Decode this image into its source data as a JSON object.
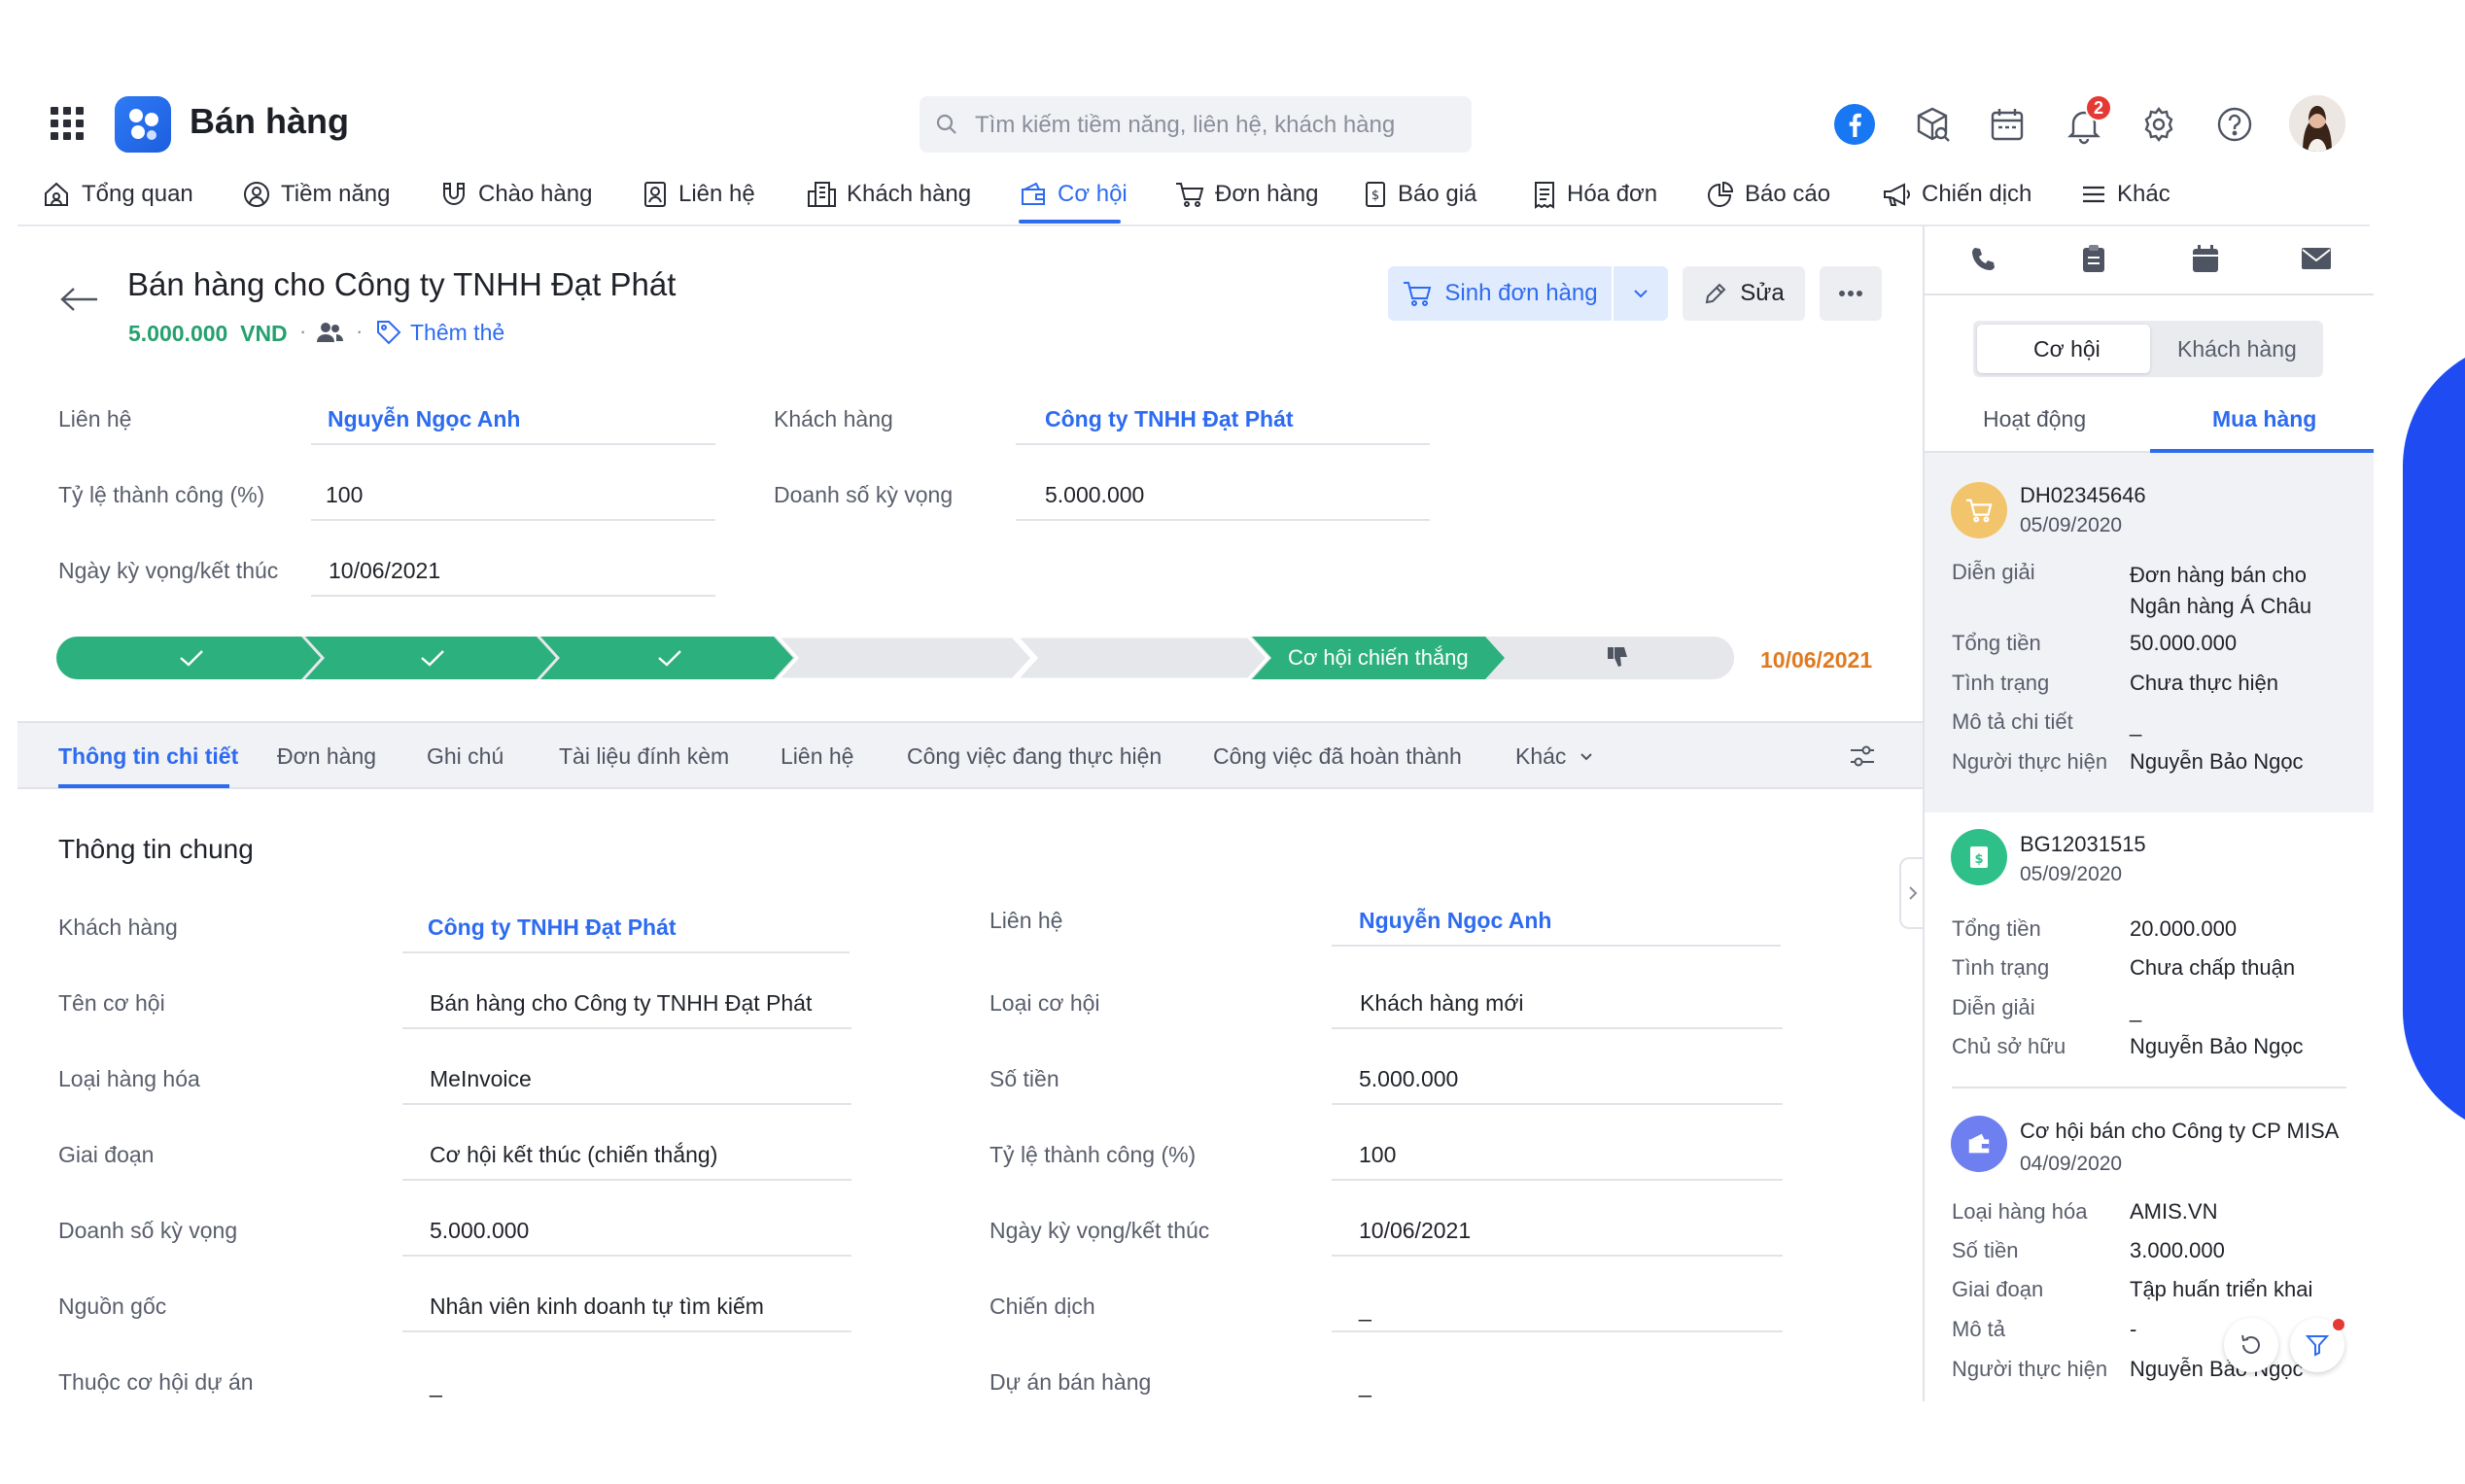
{
  "header": {
    "app_title": "Bán hàng",
    "search_placeholder": "Tìm kiếm tiềm năng, liên hệ, khách hàng",
    "notification_count": "2"
  },
  "nav": [
    {
      "label": "Tổng quan",
      "icon": "home-icon"
    },
    {
      "label": "Tiềm năng",
      "icon": "lead-icon"
    },
    {
      "label": "Chào hàng",
      "icon": "magnet-icon"
    },
    {
      "label": "Liên hệ",
      "icon": "contact-icon"
    },
    {
      "label": "Khách hàng",
      "icon": "building-icon"
    },
    {
      "label": "Cơ hội",
      "icon": "wallet-icon",
      "active": true
    },
    {
      "label": "Đơn hàng",
      "icon": "cart-icon"
    },
    {
      "label": "Báo giá",
      "icon": "quote-icon"
    },
    {
      "label": "Hóa đơn",
      "icon": "invoice-icon"
    },
    {
      "label": "Báo cáo",
      "icon": "report-icon"
    },
    {
      "label": "Chiến dịch",
      "icon": "megaphone-icon"
    },
    {
      "label": "Khác",
      "icon": "menu-icon"
    }
  ],
  "record": {
    "title": "Bán hàng cho Công ty TNHH Đạt Phát",
    "amount": "5.000.000",
    "currency": "VND",
    "add_tag": "Thêm thẻ",
    "actions": {
      "create_order": "Sinh đơn hàng",
      "edit": "Sửa"
    }
  },
  "summary": {
    "contact_label": "Liên hệ",
    "contact_value": "Nguyễn Ngọc Anh",
    "customer_label": "Khách hàng",
    "customer_value": "Công ty TNHH Đạt Phát",
    "rate_label": "Tỷ lệ thành công (%)",
    "rate_value": "100",
    "revenue_label": "Doanh số kỳ vọng",
    "revenue_value": "5.000.000",
    "date_label": "Ngày kỳ vọng/kết thúc",
    "date_value": "10/06/2021"
  },
  "pipeline": {
    "won_label": "Cơ hội chiến thắng",
    "end_date": "10/06/2021",
    "colors": {
      "done": "#2cb07e",
      "pending": "#e6e7eb"
    }
  },
  "tabs": [
    "Thông tin chi tiết",
    "Đơn hàng",
    "Ghi chú",
    "Tài liệu đính kèm",
    "Liên hệ",
    "Công việc đang thực hiện",
    "Công việc đã hoàn thành",
    "Khác"
  ],
  "detail": {
    "section_title": "Thông tin chung",
    "left": [
      {
        "label": "Khách hàng",
        "value": "Công ty TNHH Đạt Phát",
        "link": true
      },
      {
        "label": "Tên cơ hội",
        "value": "Bán hàng cho Công ty TNHH Đạt Phát"
      },
      {
        "label": "Loại hàng hóa",
        "value": "MeInvoice"
      },
      {
        "label": "Giai đoạn",
        "value": "Cơ hội kết thúc (chiến thắng)"
      },
      {
        "label": "Doanh số kỳ vọng",
        "value": "5.000.000"
      },
      {
        "label": "Nguồn gốc",
        "value": "Nhân viên kinh doanh tự tìm kiếm"
      },
      {
        "label": "Thuộc cơ hội dự án",
        "value": "_"
      }
    ],
    "right": [
      {
        "label": "Liên hệ",
        "value": "Nguyễn Ngọc Anh",
        "link": true
      },
      {
        "label": "Loại cơ hội",
        "value": "Khách hàng mới"
      },
      {
        "label": "Số tiền",
        "value": "5.000.000"
      },
      {
        "label": "Tỷ lệ thành công (%)",
        "value": "100"
      },
      {
        "label": "Ngày kỳ vọng/kết thúc",
        "value": "10/06/2021"
      },
      {
        "label": "Chiến dịch",
        "value": "_"
      },
      {
        "label": "Dự án bán hàng",
        "value": "_"
      }
    ]
  },
  "right_panel": {
    "segments": [
      "Cơ hội",
      "Khách hàng"
    ],
    "tabs": [
      "Hoạt động",
      "Mua hàng"
    ],
    "cards": [
      {
        "code": "DH02345646",
        "date": "05/09/2020",
        "icon": "cart-icon",
        "color": "#f2c46b",
        "rows": [
          {
            "label": "Diễn giải",
            "value": "Đơn hàng bán cho Ngân hàng Á Châu"
          },
          {
            "label": "Tổng tiền",
            "value": "50.000.000"
          },
          {
            "label": "Tình trạng",
            "value": "Chưa thực hiện"
          },
          {
            "label": "Mô tả chi tiết",
            "value": "_"
          },
          {
            "label": "Người thực hiện",
            "value": "Nguyễn Bảo Ngọc"
          }
        ]
      },
      {
        "code": "BG12031515",
        "date": "05/09/2020",
        "icon": "quote-icon",
        "color": "#2fc08a",
        "rows": [
          {
            "label": "Tổng tiền",
            "value": "20.000.000"
          },
          {
            "label": "Tình trạng",
            "value": "Chưa chấp thuận"
          },
          {
            "label": "Diễn giải",
            "value": "_"
          },
          {
            "label": "Chủ sở hữu",
            "value": "Nguyễn Bảo Ngọc"
          }
        ]
      },
      {
        "code": "Cơ hội bán cho Công ty CP MISA",
        "date": "04/09/2020",
        "icon": "wallet-icon",
        "color": "#6e7ff0",
        "rows": [
          {
            "label": "Loại hàng hóa",
            "value": "AMIS.VN"
          },
          {
            "label": "Số tiền",
            "value": "3.000.000"
          },
          {
            "label": "Giai đoạn",
            "value": "Tập huấn triển khai"
          },
          {
            "label": "Mô tả",
            "value": "-"
          },
          {
            "label": "Người thực hiện",
            "value": "Nguyễn Bảo Ngọc"
          }
        ]
      }
    ]
  },
  "colors": {
    "accent": "#2d6bf0",
    "success": "#25a06f",
    "warning": "#e07a21",
    "badge": "#e53935"
  }
}
